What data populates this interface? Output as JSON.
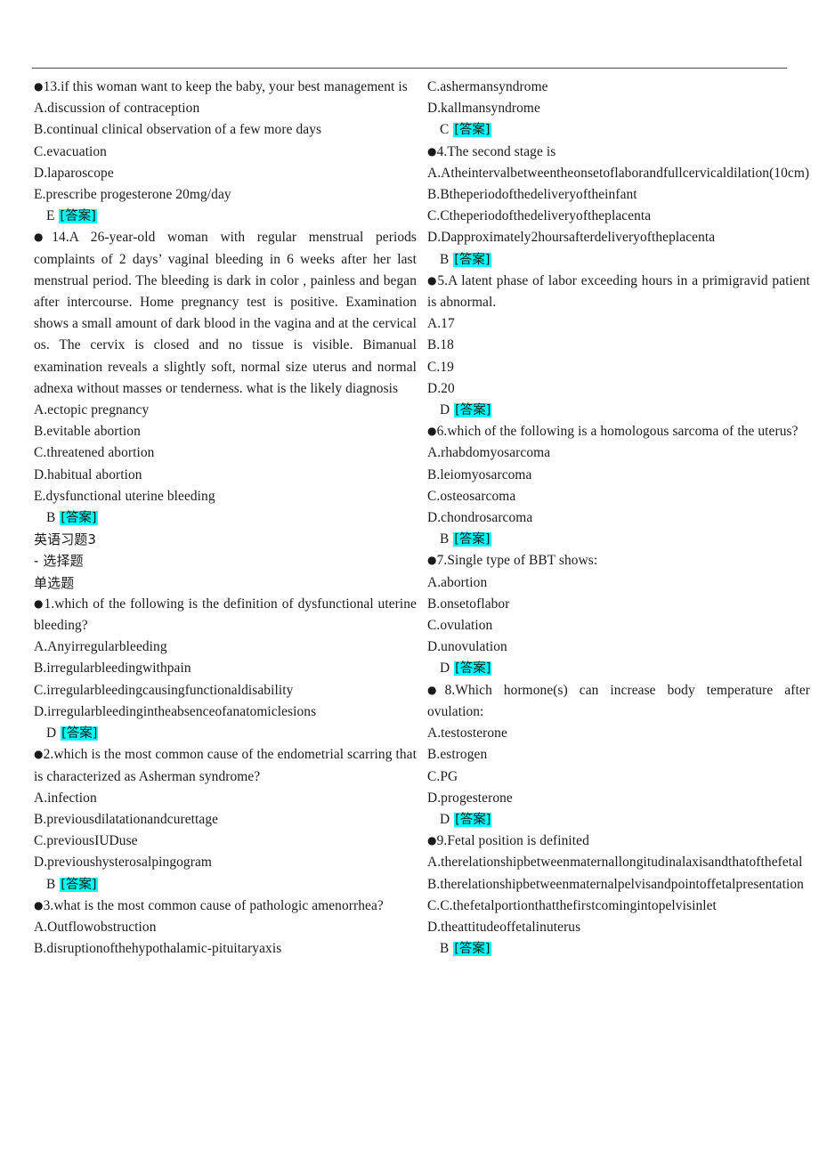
{
  "colors": {
    "answer_highlight": "#00ffff",
    "text": "#1a1a1a",
    "rule": "#4a4a4a"
  },
  "left_column": {
    "blocks": [
      {
        "kind": "question",
        "bullet": "●",
        "text": "13.if this woman want to keep the baby, your best management is"
      },
      {
        "kind": "option",
        "text": "A.discussion of contraception"
      },
      {
        "kind": "option",
        "text": "B.continual clinical observation of a few more days"
      },
      {
        "kind": "option",
        "text": "C.evacuation"
      },
      {
        "kind": "option",
        "text": "D.laparoscope"
      },
      {
        "kind": "option",
        "text": "E.prescribe progesterone 20mg/day"
      },
      {
        "kind": "answer",
        "letter": "E",
        "tag": "[答案]"
      },
      {
        "kind": "question",
        "bullet": "●",
        "text": "14.A 26-year-old woman with regular menstrual periods complaints of 2 days’ vaginal bleeding in 6 weeks after her last menstrual period. The bleeding is dark in color , painless and began after intercourse. Home pregnancy test is positive. Examination shows a small amount of dark blood in the vagina and at the cervical os. The cervix is closed and no tissue is visible. Bimanual examination reveals a slightly soft, normal size uterus and normal adnexa without masses or tenderness. what is the likely diagnosis"
      },
      {
        "kind": "option",
        "text": "A.ectopic pregnancy"
      },
      {
        "kind": "option",
        "text": "B.evitable abortion"
      },
      {
        "kind": "option",
        "text": "C.threatened abortion"
      },
      {
        "kind": "option",
        "text": "D.habitual abortion"
      },
      {
        "kind": "option",
        "text": "E.dysfunctional uterine bleeding"
      },
      {
        "kind": "answer",
        "letter": "B",
        "tag": "[答案]"
      },
      {
        "kind": "heading-cjk",
        "text": "英语习题3"
      },
      {
        "kind": "heading-cjk",
        "text": "- 选择题"
      },
      {
        "kind": "heading-cjk",
        "text": "单选题"
      },
      {
        "kind": "question",
        "bullet": "●",
        "text": "1.which of the following is the definition of dysfunctional uterine bleeding?"
      },
      {
        "kind": "option",
        "text": "A.Anyirregularbleeding"
      },
      {
        "kind": "option",
        "text": "B.irregularbleedingwithpain"
      },
      {
        "kind": "option",
        "text": "C.irregularbleedingcausingfunctionaldisability"
      },
      {
        "kind": "option",
        "text": "D.irregularbleedingintheabsenceofanatomiclesions"
      },
      {
        "kind": "answer",
        "letter": "D",
        "tag": "[答案]"
      },
      {
        "kind": "question",
        "bullet": "●",
        "text": "2.which is the most common cause of the endometrial scarring that is characterized as Asherman syndrome?"
      },
      {
        "kind": "option",
        "text": "A.infection"
      },
      {
        "kind": "option",
        "text": "B.previousdilatationandcurettage"
      },
      {
        "kind": "option",
        "text": "C.previousIUDuse"
      },
      {
        "kind": "option",
        "text": "D.previoushysterosalpingogram"
      },
      {
        "kind": "answer",
        "letter": "B",
        "tag": "[答案]"
      },
      {
        "kind": "question",
        "bullet": "●",
        "text": "3.what is the most common cause of pathologic amenorrhea?"
      },
      {
        "kind": "option",
        "text": "A.Outflowobstruction"
      },
      {
        "kind": "option",
        "text": "B.disruptionofthehypothalamic-pituitaryaxis"
      }
    ]
  },
  "right_column": {
    "blocks": [
      {
        "kind": "option",
        "text": "C.ashermansyndrome"
      },
      {
        "kind": "option",
        "text": "D.kallmansyndrome"
      },
      {
        "kind": "answer",
        "letter": "C",
        "tag": "[答案]"
      },
      {
        "kind": "question",
        "bullet": "●",
        "text": "4.The second stage is"
      },
      {
        "kind": "option",
        "text": "A.Atheintervalbetweentheonsetoflaborandfullcervicaldilation(10cm)"
      },
      {
        "kind": "option",
        "text": "B.Btheperiodofthedeliveryoftheinfant"
      },
      {
        "kind": "option",
        "text": "C.Ctheperiodofthedeliveryoftheplacenta"
      },
      {
        "kind": "option",
        "text": "D.Dapproximately2hoursafterdeliveryoftheplacenta"
      },
      {
        "kind": "answer",
        "letter": "B",
        "tag": "[答案]"
      },
      {
        "kind": "question",
        "bullet": "●",
        "text": "5.A latent phase of labor exceeding hours in a primigravid patient is abnormal."
      },
      {
        "kind": "option",
        "text": "A.17"
      },
      {
        "kind": "option",
        "text": "B.18"
      },
      {
        "kind": "option",
        "text": "C.19"
      },
      {
        "kind": "option",
        "text": "D.20"
      },
      {
        "kind": "answer",
        "letter": "D",
        "tag": "[答案]"
      },
      {
        "kind": "question",
        "bullet": "●",
        "text": "6.which of the following is a homologous sarcoma of the uterus?"
      },
      {
        "kind": "option",
        "text": "A.rhabdomyosarcoma"
      },
      {
        "kind": "option",
        "text": "B.leiomyosarcoma"
      },
      {
        "kind": "option",
        "text": "C.osteosarcoma"
      },
      {
        "kind": "option",
        "text": "D.chondrosarcoma"
      },
      {
        "kind": "answer",
        "letter": "B",
        "tag": "[答案]"
      },
      {
        "kind": "question",
        "bullet": "●",
        "text": "7.Single type of BBT shows:"
      },
      {
        "kind": "option",
        "text": "A.abortion"
      },
      {
        "kind": "option",
        "text": "B.onsetoflabor"
      },
      {
        "kind": "option",
        "text": "C.ovulation"
      },
      {
        "kind": "option",
        "text": "D.unovulation"
      },
      {
        "kind": "answer",
        "letter": "D",
        "tag": "[答案]"
      },
      {
        "kind": "question",
        "bullet": "●",
        "text": "8.Which hormone(s) can increase body temperature after ovulation:"
      },
      {
        "kind": "option",
        "text": "A.testosterone"
      },
      {
        "kind": "option",
        "text": "B.estrogen"
      },
      {
        "kind": "option",
        "text": "C.PG"
      },
      {
        "kind": "option",
        "text": "D.progesterone"
      },
      {
        "kind": "answer",
        "letter": "D",
        "tag": "[答案]"
      },
      {
        "kind": "question",
        "bullet": "●",
        "text": "9.Fetal position is definited"
      },
      {
        "kind": "option",
        "text": "A.therelationshipbetweenmaternallongitudinalaxisandthatofthefetal"
      },
      {
        "kind": "option",
        "text": "B.therelationshipbetweenmaternalpelvisandpointoffetalpresentation"
      },
      {
        "kind": "option",
        "text": "C.C.thefetalportionthatthefirstcomingintopelvisinlet"
      },
      {
        "kind": "option",
        "text": "D.theattitudeoffetalinuterus"
      },
      {
        "kind": "answer",
        "letter": "B",
        "tag": "[答案]"
      }
    ]
  }
}
